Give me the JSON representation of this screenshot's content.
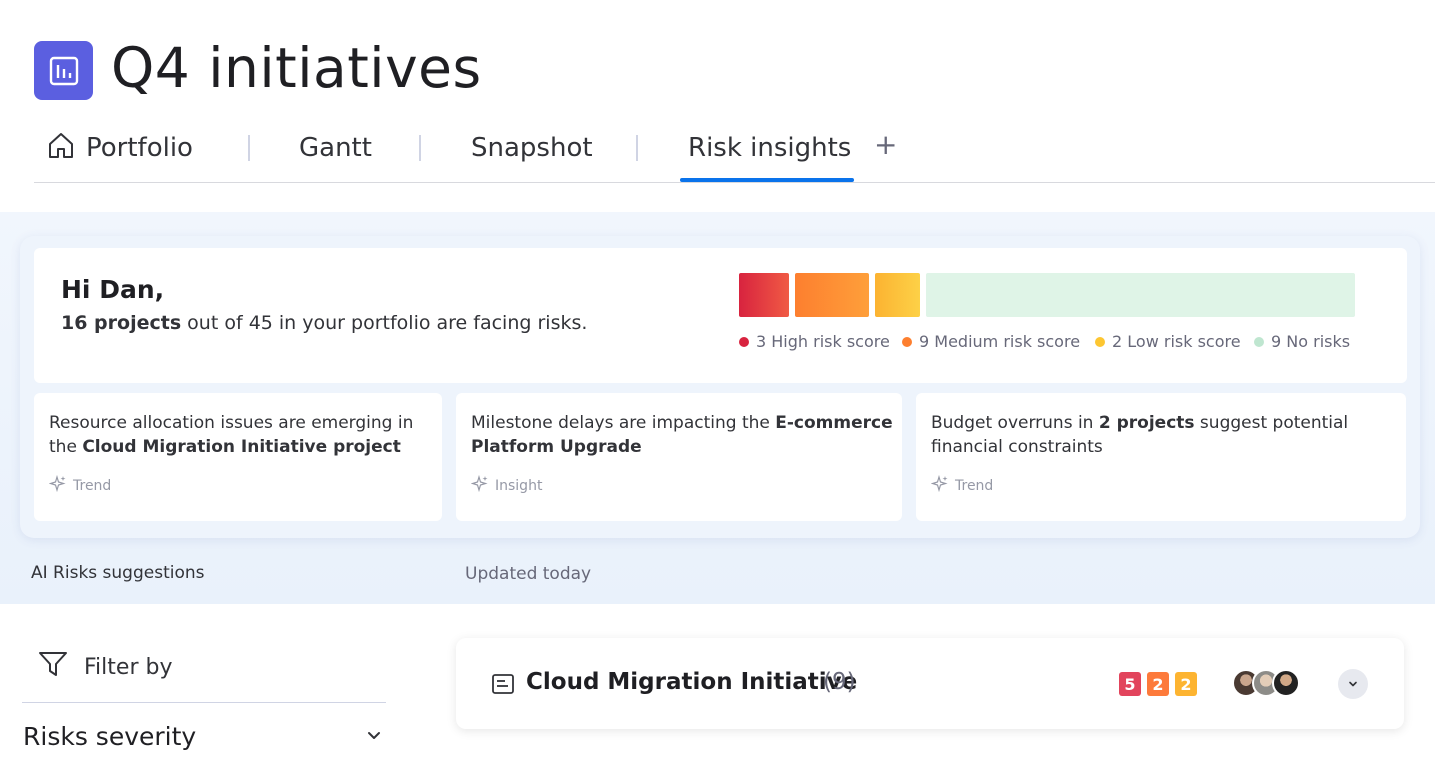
{
  "header": {
    "title": "Q4 initiatives",
    "app_icon": "board-chart-icon",
    "accent_color": "#5b5fe0"
  },
  "tabs": [
    {
      "label": "Portfolio",
      "icon": "home-icon"
    },
    {
      "label": "Gantt"
    },
    {
      "label": "Snapshot"
    },
    {
      "label": "Risk insights",
      "active": true
    }
  ],
  "add_tab_label": "+",
  "greeting": {
    "title": "Hi Dan,",
    "summary_bold": "16 projects",
    "summary_rest": " out of 45 in your portfolio are facing risks."
  },
  "risk_summary": {
    "segments": [
      {
        "label": "3 High risk score",
        "count": 3,
        "color": "#e2445c"
      },
      {
        "label": "9 Medium risk score",
        "count": 9,
        "color": "#fd8a2b"
      },
      {
        "label": "2 Low risk score",
        "count": 2,
        "color": "#fdc631"
      },
      {
        "label": "9 No risks",
        "count": 9,
        "color": "#bfe6d0"
      }
    ]
  },
  "insights": [
    {
      "line1": "Resource allocation issues are emerging in",
      "line2_pre": "the ",
      "line2_bold": "Cloud Migration Initiative project",
      "tag": "Trend"
    },
    {
      "line1_pre": "Milestone delays are impacting the ",
      "line1_bold": "E-commerce",
      "line2_bold": "Platform Upgrade",
      "tag": "Insight"
    },
    {
      "line1_pre": "Budget overruns in ",
      "line1_bold": "2 projects",
      "line1_post": " suggest potential",
      "line2": "financial constraints",
      "tag": "Trend"
    }
  ],
  "ai_section": {
    "label": "AI Risks suggestions",
    "updated": "Updated today"
  },
  "filter": {
    "label": "Filter by",
    "severity_label": "Risks severity"
  },
  "project": {
    "name": "Cloud Migration Initiative",
    "count": "(9)",
    "badges": [
      {
        "value": "5",
        "color": "#e2445c"
      },
      {
        "value": "2",
        "color": "#fd7a3b"
      },
      {
        "value": "2",
        "color": "#fdb431"
      }
    ],
    "avatars": [
      "avatar-1",
      "avatar-2",
      "avatar-3"
    ]
  }
}
